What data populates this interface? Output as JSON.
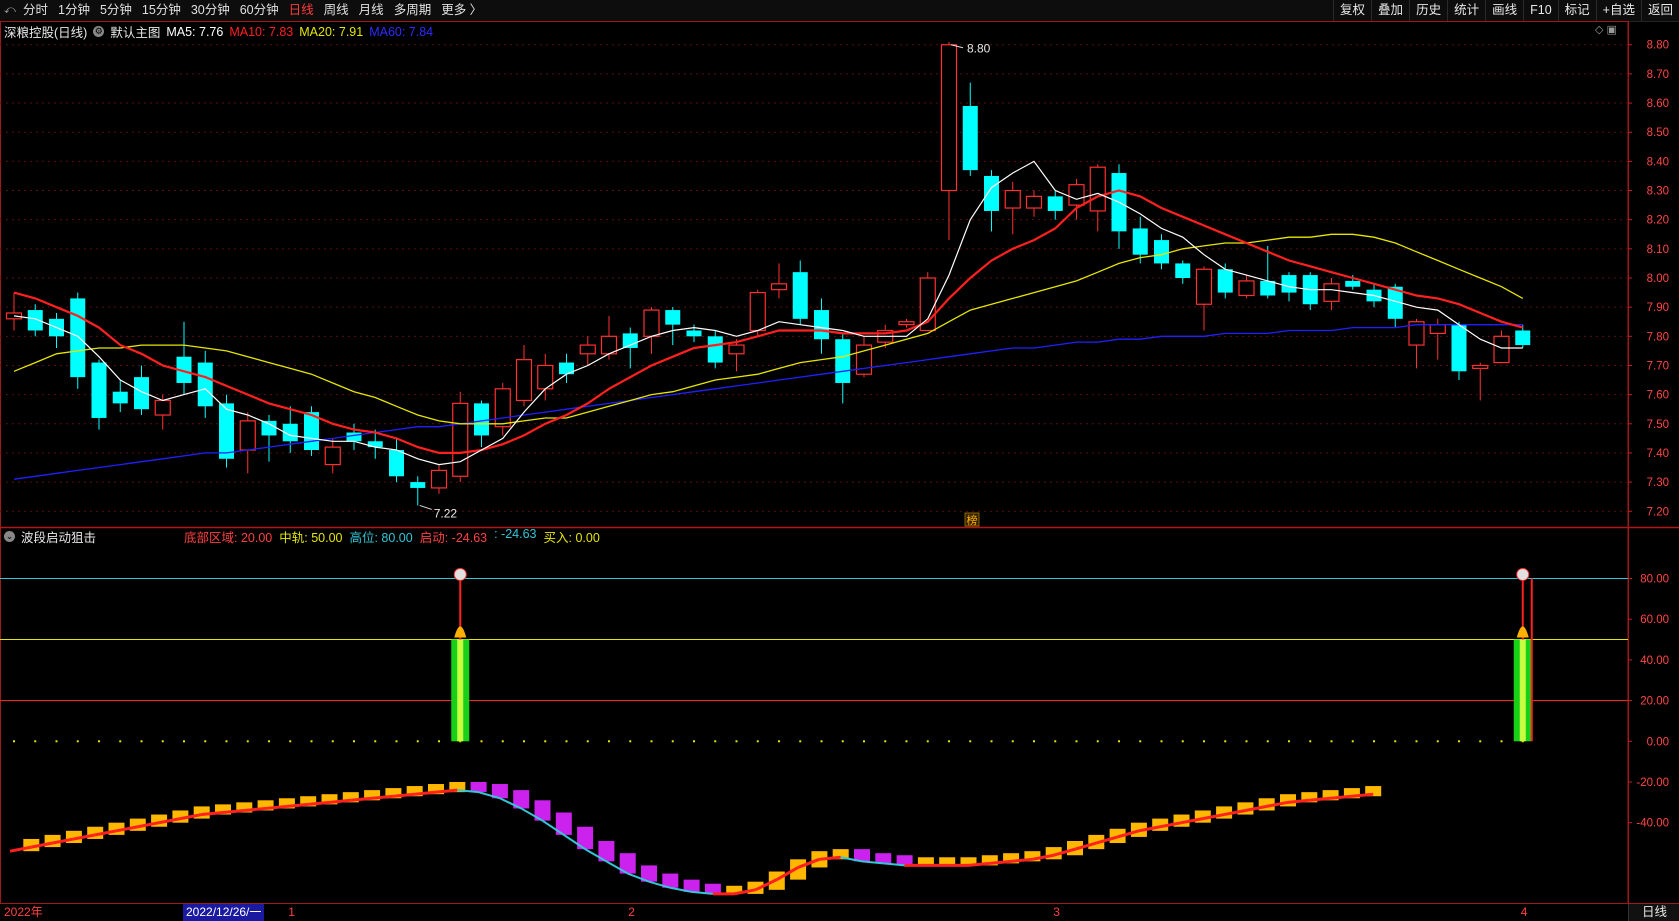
{
  "toolbar": {
    "periods": [
      "分时",
      "1分钟",
      "5分钟",
      "15分钟",
      "30分钟",
      "60分钟",
      "日线",
      "周线",
      "月线",
      "多周期",
      "更多 〉"
    ],
    "active_period": "日线",
    "right_buttons": [
      "复权",
      "叠加",
      "历史",
      "统计",
      "画线",
      "F10",
      "标记",
      "+自选",
      "返回"
    ]
  },
  "main_chart": {
    "stock_name": "深粮控股(日线)",
    "template": "默认主图",
    "ma5_label": "MA5: 7.76",
    "ma10_label": "MA10: 7.83",
    "ma20_label": "MA20: 7.91",
    "ma60_label": "MA60: 7.84",
    "colors": {
      "ma5": "#ffffff",
      "ma10": "#ff2020",
      "ma20": "#e6e600",
      "ma60": "#2020ff",
      "up": "#ff3030",
      "down": "#00ffff"
    },
    "high_marker": "8.80",
    "low_marker": "7.22",
    "badge": "榜",
    "y_axis": [
      "8.80",
      "8.70",
      "8.60",
      "8.50",
      "8.40",
      "8.30",
      "8.20",
      "8.10",
      "8.00",
      "7.90",
      "7.80",
      "7.70",
      "7.60",
      "7.50",
      "7.40",
      "7.30",
      "7.20"
    ],
    "ylim": [
      7.17,
      8.83
    ],
    "candles": [
      [
        7.86,
        7.88,
        7.95,
        7.82
      ],
      [
        7.89,
        7.82,
        7.91,
        7.8
      ],
      [
        7.86,
        7.8,
        7.88,
        7.76
      ],
      [
        7.93,
        7.66,
        7.95,
        7.62
      ],
      [
        7.71,
        7.52,
        7.72,
        7.48
      ],
      [
        7.61,
        7.57,
        7.65,
        7.54
      ],
      [
        7.66,
        7.55,
        7.7,
        7.53
      ],
      [
        7.53,
        7.58,
        7.6,
        7.48
      ],
      [
        7.73,
        7.64,
        7.85,
        7.6
      ],
      [
        7.71,
        7.56,
        7.75,
        7.52
      ],
      [
        7.57,
        7.38,
        7.6,
        7.35
      ],
      [
        7.41,
        7.51,
        7.54,
        7.33
      ],
      [
        7.51,
        7.46,
        7.53,
        7.37
      ],
      [
        7.5,
        7.44,
        7.56,
        7.4
      ],
      [
        7.54,
        7.41,
        7.56,
        7.39
      ],
      [
        7.36,
        7.42,
        7.45,
        7.33
      ],
      [
        7.47,
        7.44,
        7.5,
        7.41
      ],
      [
        7.44,
        7.42,
        7.48,
        7.38
      ],
      [
        7.41,
        7.32,
        7.45,
        7.3
      ],
      [
        7.3,
        7.28,
        7.32,
        7.22
      ],
      [
        7.28,
        7.34,
        7.36,
        7.26
      ],
      [
        7.32,
        7.57,
        7.61,
        7.3
      ],
      [
        7.57,
        7.46,
        7.58,
        7.42
      ],
      [
        7.49,
        7.62,
        7.64,
        7.46
      ],
      [
        7.58,
        7.72,
        7.77,
        7.56
      ],
      [
        7.62,
        7.7,
        7.74,
        7.58
      ],
      [
        7.71,
        7.67,
        7.74,
        7.64
      ],
      [
        7.74,
        7.77,
        7.8,
        7.7
      ],
      [
        7.74,
        7.8,
        7.87,
        7.72
      ],
      [
        7.81,
        7.76,
        7.83,
        7.69
      ],
      [
        7.8,
        7.89,
        7.9,
        7.74
      ],
      [
        7.89,
        7.84,
        7.9,
        7.77
      ],
      [
        7.82,
        7.8,
        7.84,
        7.78
      ],
      [
        7.8,
        7.71,
        7.82,
        7.69
      ],
      [
        7.74,
        7.77,
        7.79,
        7.68
      ],
      [
        7.82,
        7.95,
        7.96,
        7.8
      ],
      [
        7.96,
        7.98,
        8.05,
        7.93
      ],
      [
        8.02,
        7.86,
        8.06,
        7.84
      ],
      [
        7.89,
        7.79,
        7.93,
        7.74
      ],
      [
        7.79,
        7.64,
        7.81,
        7.57
      ],
      [
        7.67,
        7.77,
        7.8,
        7.66
      ],
      [
        7.78,
        7.82,
        7.84,
        7.76
      ],
      [
        7.84,
        7.85,
        7.86,
        7.83
      ],
      [
        7.82,
        8.0,
        8.02,
        7.82
      ],
      [
        8.3,
        8.8,
        8.81,
        8.13
      ],
      [
        8.59,
        8.37,
        8.67,
        8.35
      ],
      [
        8.35,
        8.23,
        8.37,
        8.16
      ],
      [
        8.24,
        8.3,
        8.33,
        8.15
      ],
      [
        8.24,
        8.28,
        8.3,
        8.21
      ],
      [
        8.28,
        8.23,
        8.3,
        8.2
      ],
      [
        8.25,
        8.32,
        8.34,
        8.2
      ],
      [
        8.23,
        8.38,
        8.39,
        8.16
      ],
      [
        8.36,
        8.16,
        8.39,
        8.1
      ],
      [
        8.17,
        8.08,
        8.21,
        8.05
      ],
      [
        8.13,
        8.05,
        8.15,
        8.03
      ],
      [
        8.05,
        8.0,
        8.06,
        7.98
      ],
      [
        7.91,
        8.03,
        8.04,
        7.82
      ],
      [
        8.03,
        7.95,
        8.05,
        7.93
      ],
      [
        7.94,
        7.99,
        8.01,
        7.93
      ],
      [
        7.99,
        7.94,
        8.11,
        7.93
      ],
      [
        8.01,
        7.95,
        8.02,
        7.92
      ],
      [
        8.01,
        7.91,
        8.02,
        7.89
      ],
      [
        7.92,
        7.98,
        8.0,
        7.89
      ],
      [
        7.99,
        7.97,
        8.01,
        7.96
      ],
      [
        7.96,
        7.92,
        7.98,
        7.9
      ],
      [
        7.97,
        7.86,
        7.98,
        7.83
      ],
      [
        7.77,
        7.85,
        7.86,
        7.69
      ],
      [
        7.81,
        7.84,
        7.86,
        7.72
      ],
      [
        7.84,
        7.68,
        7.85,
        7.65
      ],
      [
        7.69,
        7.7,
        7.71,
        7.58
      ],
      [
        7.71,
        7.8,
        7.82,
        7.71
      ],
      [
        7.82,
        7.77,
        7.84,
        7.76
      ]
    ],
    "ma5": [
      7.87,
      7.86,
      7.83,
      7.8,
      7.73,
      7.65,
      7.61,
      7.58,
      7.6,
      7.62,
      7.55,
      7.53,
      7.5,
      7.46,
      7.45,
      7.44,
      7.44,
      7.42,
      7.41,
      7.38,
      7.36,
      7.37,
      7.41,
      7.45,
      7.54,
      7.62,
      7.67,
      7.7,
      7.74,
      7.77,
      7.8,
      7.82,
      7.83,
      7.82,
      7.8,
      7.82,
      7.85,
      7.84,
      7.83,
      7.82,
      7.8,
      7.8,
      7.8,
      7.86,
      8.01,
      8.2,
      8.31,
      8.36,
      8.4,
      8.3,
      8.27,
      8.29,
      8.26,
      8.22,
      8.17,
      8.14,
      8.08,
      8.03,
      8.01,
      7.99,
      7.97,
      7.96,
      7.96,
      7.95,
      7.94,
      7.92,
      7.9,
      7.89,
      7.84,
      7.79,
      7.76,
      7.76
    ],
    "ma10": [
      7.95,
      7.93,
      7.9,
      7.87,
      7.83,
      7.77,
      7.74,
      7.7,
      7.68,
      7.66,
      7.63,
      7.6,
      7.57,
      7.55,
      7.53,
      7.5,
      7.48,
      7.47,
      7.45,
      7.42,
      7.4,
      7.4,
      7.41,
      7.43,
      7.46,
      7.5,
      7.53,
      7.57,
      7.62,
      7.66,
      7.7,
      7.73,
      7.76,
      7.77,
      7.78,
      7.8,
      7.82,
      7.82,
      7.82,
      7.81,
      7.81,
      7.81,
      7.82,
      7.85,
      7.93,
      8.0,
      8.06,
      8.1,
      8.13,
      8.17,
      8.24,
      8.28,
      8.3,
      8.28,
      8.24,
      8.21,
      8.18,
      8.15,
      8.12,
      8.09,
      8.06,
      8.04,
      8.02,
      8.0,
      7.98,
      7.96,
      7.94,
      7.93,
      7.91,
      7.88,
      7.85,
      7.83
    ],
    "ma20": [
      7.68,
      7.71,
      7.74,
      7.75,
      7.76,
      7.76,
      7.77,
      7.77,
      7.77,
      7.76,
      7.75,
      7.73,
      7.71,
      7.69,
      7.67,
      7.64,
      7.61,
      7.59,
      7.56,
      7.53,
      7.51,
      7.5,
      7.5,
      7.5,
      7.51,
      7.52,
      7.52,
      7.54,
      7.56,
      7.58,
      7.6,
      7.61,
      7.63,
      7.65,
      7.66,
      7.67,
      7.69,
      7.71,
      7.72,
      7.73,
      7.75,
      7.77,
      7.79,
      7.81,
      7.85,
      7.89,
      7.91,
      7.93,
      7.95,
      7.97,
      7.99,
      8.02,
      8.05,
      8.07,
      8.08,
      8.1,
      8.11,
      8.12,
      8.12,
      8.13,
      8.14,
      8.14,
      8.15,
      8.15,
      8.14,
      8.12,
      8.09,
      8.06,
      8.03,
      8.0,
      7.97,
      7.93
    ],
    "ma60": [
      7.31,
      7.32,
      7.33,
      7.34,
      7.35,
      7.36,
      7.37,
      7.38,
      7.39,
      7.4,
      7.4,
      7.41,
      7.42,
      7.43,
      7.44,
      7.45,
      7.46,
      7.47,
      7.48,
      7.49,
      7.49,
      7.5,
      7.51,
      7.52,
      7.53,
      7.54,
      7.55,
      7.56,
      7.57,
      7.58,
      7.59,
      7.6,
      7.61,
      7.62,
      7.63,
      7.64,
      7.65,
      7.66,
      7.67,
      7.68,
      7.69,
      7.7,
      7.71,
      7.72,
      7.73,
      7.74,
      7.75,
      7.76,
      7.76,
      7.77,
      7.78,
      7.78,
      7.79,
      7.79,
      7.8,
      7.8,
      7.8,
      7.81,
      7.81,
      7.81,
      7.82,
      7.82,
      7.82,
      7.83,
      7.83,
      7.83,
      7.84,
      7.84,
      7.84,
      7.84,
      7.84,
      7.84
    ]
  },
  "indicator": {
    "name": "波段启动狙击",
    "labels": [
      {
        "text": "底部区域: 20.00",
        "color": "#ff4040"
      },
      {
        "text": "中轨: 50.00",
        "color": "#e6e600"
      },
      {
        "text": "高位: 80.00",
        "color": "#33c6d6"
      },
      {
        "text": "启动: -24.63",
        "color": "#ff4040"
      },
      {
        "text": ": -24.63",
        "color": "#33c6d6"
      },
      {
        "text": "买入: 0.00",
        "color": "#e6e600"
      }
    ],
    "y_axis": [
      "80.00",
      "60.00",
      "40.00",
      "20.00",
      "0.00",
      "-20.00",
      "-40.00"
    ],
    "ylim": [
      -78,
      95
    ],
    "levels": {
      "high": 80,
      "mid": 50,
      "low": 20
    },
    "signals": [
      21,
      71
    ],
    "curve": [
      -52,
      -50,
      -48,
      -46,
      -44,
      -42,
      -40,
      -38,
      -36,
      -34,
      -33,
      -32,
      -31,
      -30,
      -29,
      -28,
      -27,
      -26,
      -25,
      -24,
      -23,
      -22,
      -23,
      -26,
      -31,
      -37,
      -44,
      -51,
      -57,
      -63,
      -67,
      -70,
      -72,
      -73,
      -73,
      -71,
      -66,
      -60,
      -56,
      -55,
      -57,
      -58,
      -59,
      -59,
      -59,
      -59,
      -58,
      -57,
      -56,
      -54,
      -51,
      -48,
      -45,
      -42,
      -40,
      -38,
      -36,
      -34,
      -32,
      -30,
      -28,
      -27,
      -26,
      -25,
      -24
    ]
  },
  "time_axis": {
    "year_label": "2022年",
    "cursor_date": "2022/12/26/一",
    "months": [
      {
        "label": "1",
        "idx": 13
      },
      {
        "label": "2",
        "idx": 29
      },
      {
        "label": "3",
        "idx": 49
      },
      {
        "label": "4",
        "idx": 71
      }
    ],
    "period_label": "日线"
  }
}
